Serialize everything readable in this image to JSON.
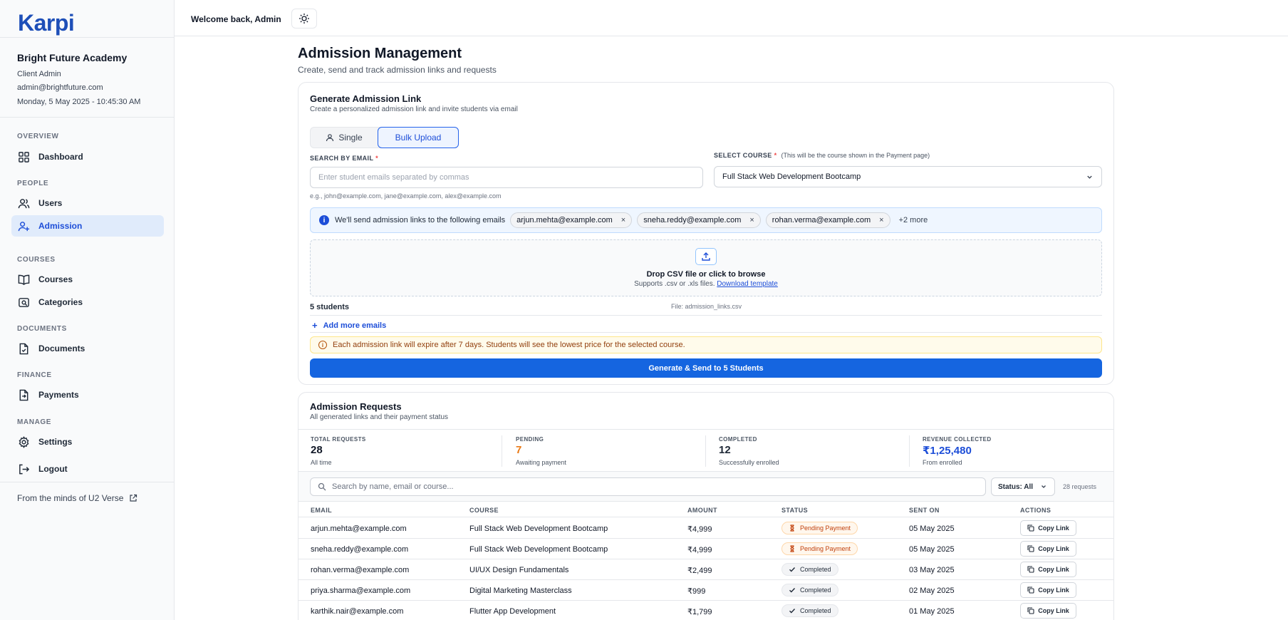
{
  "brand": {
    "logo": "Karpi"
  },
  "org": {
    "name": "Bright Future Academy",
    "role": "Client Admin",
    "email": "admin@brightfuture.com",
    "datetime": "Monday, 5 May 2025 - 10:45:30 AM"
  },
  "nav": {
    "overview": "OVERVIEW",
    "dashboard": "Dashboard",
    "people": "PEOPLE",
    "users": "Users",
    "admission": "Admission",
    "courses_sec": "COURSES",
    "courses": "Courses",
    "categories": "Categories",
    "documents_sec": "DOCUMENTS",
    "documents": "Documents",
    "finance": "FINANCE",
    "payments": "Payments",
    "manage": "MANAGE",
    "settings": "Settings",
    "logout": "Logout",
    "footer": "From the minds of U2 Verse"
  },
  "topbar": {
    "welcome": "Welcome back, Admin"
  },
  "page": {
    "title": "Admission Management",
    "subtitle": "Create, send and track admission links and requests"
  },
  "generate": {
    "title": "Generate Admission Link",
    "desc": "Create a personalized admission link and invite students via email",
    "tab_single": "Single",
    "tab_bulk": "Bulk Upload",
    "email_label": "SEARCH BY EMAIL",
    "required": "*",
    "email_placeholder": "Enter student emails separated by commas",
    "email_hint": "e.g., john@example.com, jane@example.com, alex@example.com",
    "course_label": "SELECT COURSE",
    "course_note": "(This will be the course shown in the Payment page)",
    "course_value": "Full Stack Web Development Bootcamp",
    "info_text": "We'll send admission links to the following emails",
    "chips": [
      "arjun.mehta@example.com",
      "sneha.reddy@example.com",
      "rohan.verma@example.com"
    ],
    "chip_close": "×",
    "more": "+2 more",
    "drop_title": "Drop CSV file or click to browse",
    "drop_sub": "Supports .csv or .xls files.",
    "drop_link": "Download template",
    "students": "5 students",
    "file": "File: admission_links.csv",
    "add_more": "Add more emails",
    "add_plus": "+",
    "info_i": "i",
    "warn_i": "i",
    "warning": "Each admission link will expire after 7 days. Students will see the lowest price for the selected course.",
    "button": "Generate & Send to 5 Students"
  },
  "requests": {
    "title": "Admission Requests",
    "desc": "All generated links and their payment status",
    "stats": [
      {
        "label": "TOTAL REQUESTS",
        "value": "28",
        "sub": "All time",
        "color": "#111827"
      },
      {
        "label": "PENDING",
        "value": "7",
        "sub": "Awaiting payment",
        "color": "#ea7a16"
      },
      {
        "label": "COMPLETED",
        "value": "12",
        "sub": "Successfully enrolled",
        "color": "#1f2937"
      },
      {
        "label": "REVENUE COLLECTED",
        "value": "₹1,25,480",
        "sub": "From enrolled",
        "color": "#1d4ed8"
      }
    ],
    "search_placeholder": "Search by name, email or course...",
    "status_filter": "Status: All",
    "count": "28 requests",
    "columns": [
      "EMAIL",
      "COURSE",
      "AMOUNT",
      "STATUS",
      "SENT ON",
      "ACTIONS"
    ],
    "rows": [
      {
        "email": "arjun.mehta@example.com",
        "course": "Full Stack Web Development Bootcamp",
        "amount": "₹4,999",
        "status": "Pending Payment",
        "status_type": "pending",
        "sent": "05 May 2025",
        "action": "Copy Link"
      },
      {
        "email": "sneha.reddy@example.com",
        "course": "Full Stack Web Development Bootcamp",
        "amount": "₹4,999",
        "status": "Pending Payment",
        "status_type": "pending",
        "sent": "05 May 2025",
        "action": "Copy Link"
      },
      {
        "email": "rohan.verma@example.com",
        "course": "UI/UX Design Fundamentals",
        "amount": "₹2,499",
        "status": "Completed",
        "status_type": "completed",
        "sent": "03 May 2025",
        "action": "Copy Link"
      },
      {
        "email": "priya.sharma@example.com",
        "course": "Digital Marketing Masterclass",
        "amount": "₹999",
        "status": "Completed",
        "status_type": "completed",
        "sent": "02 May 2025",
        "action": "Copy Link"
      },
      {
        "email": "karthik.nair@example.com",
        "course": "Flutter App Development",
        "amount": "₹1,799",
        "status": "Completed",
        "status_type": "completed",
        "sent": "01 May 2025",
        "action": "Copy Link"
      }
    ]
  }
}
